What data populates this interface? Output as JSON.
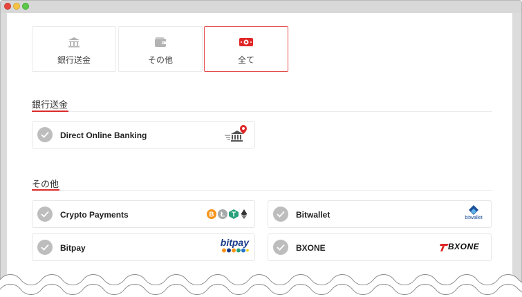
{
  "tabs": [
    {
      "label": "銀行送金",
      "icon": "bank-icon"
    },
    {
      "label": "その他",
      "icon": "wallet-icon"
    },
    {
      "label": "全て",
      "icon": "cash-icon",
      "active": true
    }
  ],
  "sections": {
    "bank": {
      "title": "銀行送金",
      "methods": [
        {
          "name": "Direct Online Banking",
          "logo": "bank-pin-logo"
        }
      ]
    },
    "other": {
      "title": "その他",
      "methods": [
        {
          "name": "Crypto Payments",
          "logo": "crypto-coins-logo"
        },
        {
          "name": "Bitwallet",
          "logo": "bitwallet-logo",
          "logo_text": "bitwallet"
        },
        {
          "name": "Bitpay",
          "logo": "bitpay-logo",
          "logo_text": "bitpay"
        },
        {
          "name": "BXONE",
          "logo": "bxone-logo",
          "logo_text": "BXONE"
        }
      ]
    }
  },
  "colors": {
    "accent": "#d92b2b",
    "check": "#bdbdbd",
    "bitcoin": "#f7931a",
    "litecoin": "#a6a9aa",
    "tether": "#26a17b",
    "bitpay": "#1a3b8b"
  }
}
